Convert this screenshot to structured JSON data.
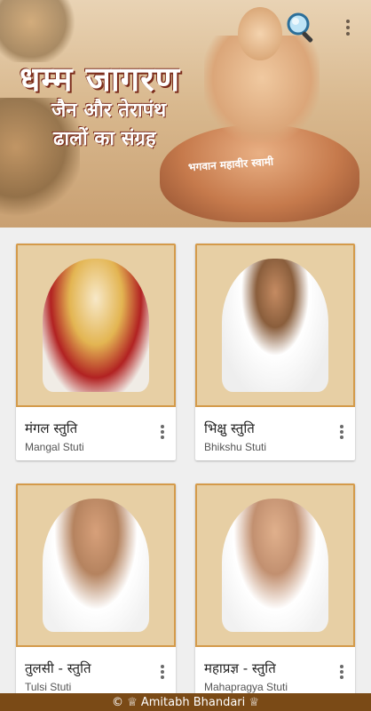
{
  "header": {
    "title": "धम्म जागरण",
    "subtitle_line1": "जैन और तेरापंथ",
    "subtitle_line2": "ढालों का संग्रह",
    "image_caption": "भगवान महावीर स्वामी",
    "search_icon": "search-icon",
    "menu_icon": "more-vert-icon"
  },
  "cards": [
    {
      "title": "मंगल स्तुति",
      "subtitle": "Mangal Stuti",
      "menu_icon": "more-vert-icon"
    },
    {
      "title": "भिक्षु स्तुति",
      "subtitle": "Bhikshu Stuti",
      "menu_icon": "more-vert-icon"
    },
    {
      "title": "तुलसी - स्तुति",
      "subtitle": "Tulsi Stuti",
      "menu_icon": "more-vert-icon"
    },
    {
      "title": "महाप्रज्ञ - स्तुति",
      "subtitle": "Mahapragya Stuti",
      "menu_icon": "more-vert-icon"
    }
  ],
  "footer": {
    "text": "© ♕ Amitabh Bhandari ♕"
  },
  "colors": {
    "footer_bg": "#7a4a16",
    "card_border": "#d49a4a",
    "accent_text": "#ffffff"
  }
}
